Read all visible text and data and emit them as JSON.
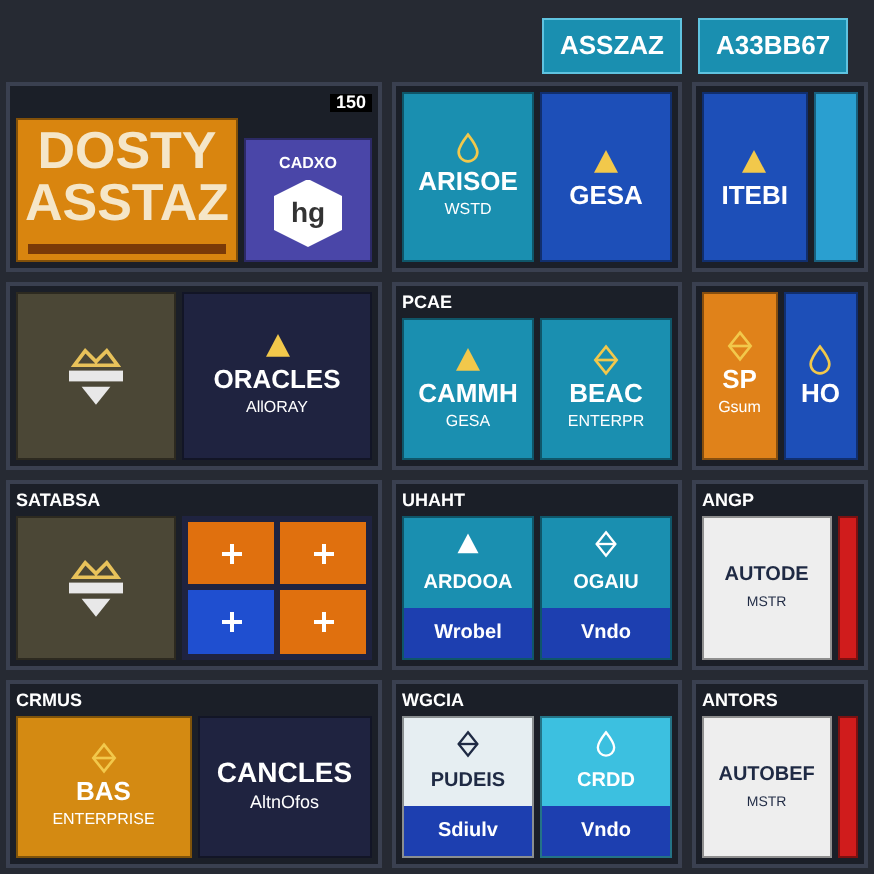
{
  "header_tabs": [
    {
      "label": "ASSZAZ"
    },
    {
      "label": "A33BB67"
    }
  ],
  "columns": [
    {
      "panels": [
        {
          "badge": "150",
          "tiles": [
            {
              "kind": "wordmark",
              "title": "DOSTY ASSTAZ",
              "color": "#d9850f"
            },
            {
              "kind": "hex",
              "title": "CADXO",
              "mark": "hg",
              "color": "#4a46a8"
            }
          ]
        },
        {
          "tiles": [
            {
              "kind": "emblem",
              "color": "#4b4736"
            },
            {
              "kind": "logo",
              "title": "ORACLES",
              "subtitle": "AllORAY",
              "color": "#1f2340"
            }
          ]
        },
        {
          "header": "SATABSA",
          "tiles": [
            {
              "kind": "emblem",
              "color": "#4b4736"
            },
            {
              "kind": "grid",
              "cells": [
                {
                  "color": "#e0700e"
                },
                {
                  "color": "#e0700e"
                },
                {
                  "color": "#1f4fd0"
                },
                {
                  "color": "#e0700e"
                }
              ]
            }
          ]
        },
        {
          "header": "CRMUS",
          "tiles": [
            {
              "kind": "logo",
              "title": "BAS",
              "subtitle": "ENTERPRISE",
              "color": "#d48a12"
            },
            {
              "kind": "wordmark",
              "title": "CANCLES",
              "subtitle": "AltnOfos",
              "color": "#1f2340"
            }
          ]
        }
      ]
    },
    {
      "panels": [
        {
          "tiles": [
            {
              "kind": "logo",
              "title": "ARISOE",
              "subtitle": "WSTD",
              "color": "#1a8fb0"
            },
            {
              "kind": "logo",
              "title": "GESA",
              "color": "#1d4fb8"
            }
          ]
        },
        {
          "header": "PCAE",
          "tiles": [
            {
              "kind": "logo",
              "title": "CAMMH",
              "subtitle": "GESA",
              "color": "#1a8fb0"
            },
            {
              "kind": "logo",
              "title": "BEAC",
              "subtitle": "ENTERPR",
              "color": "#1a8fb0"
            }
          ]
        },
        {
          "header": "UHAHT",
          "tiles": [
            {
              "kind": "split",
              "title": "ARDOOA",
              "footer": "Wrobel",
              "color": "#1a8fb0"
            },
            {
              "kind": "split",
              "title": "OGAIU",
              "footer": "Vndo",
              "color": "#1a8fb0"
            }
          ]
        },
        {
          "header": "WGCIA",
          "tiles": [
            {
              "kind": "split",
              "title": "PUDEIS",
              "footer": "Sdiulv",
              "color": "#e6eef2"
            },
            {
              "kind": "split",
              "title": "CRDD",
              "footer": "Vndo",
              "color": "#3cc0e0"
            }
          ]
        }
      ]
    },
    {
      "panels": [
        {
          "tiles": [
            {
              "kind": "logo",
              "title": "ITEBI",
              "color": "#1d4fb8"
            },
            {
              "kind": "stripe",
              "color": "#2a9fd0"
            }
          ]
        },
        {
          "tiles": [
            {
              "kind": "logo",
              "title": "SP",
              "subtitle": "Gsum",
              "color": "#e0821a"
            },
            {
              "kind": "logo",
              "title": "HO",
              "color": "#1d4fb8"
            }
          ]
        },
        {
          "header": "ANGP",
          "tiles": [
            {
              "kind": "card",
              "title": "AUTODE",
              "subtitle": "MSTR",
              "color": "#eeeeee"
            },
            {
              "kind": "stripe",
              "color": "#d01c1c"
            }
          ]
        },
        {
          "header": "ANTORS",
          "tiles": [
            {
              "kind": "card",
              "title": "AUTOBEF",
              "subtitle": "MSTR",
              "color": "#eeeeee"
            },
            {
              "kind": "stripe",
              "color": "#d01c1c"
            }
          ]
        }
      ]
    }
  ]
}
